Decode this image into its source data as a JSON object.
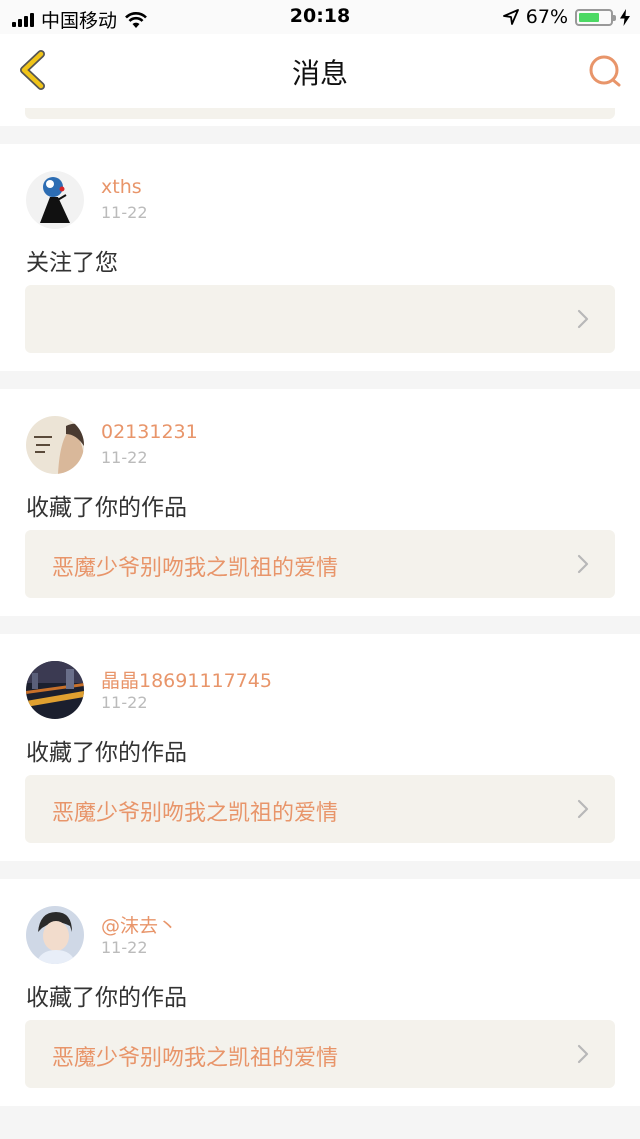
{
  "status_bar": {
    "carrier": "中国移动",
    "time": "20:18",
    "battery_percent": "67%",
    "battery_level": 0.67,
    "icons": [
      "signal-icon",
      "wifi-icon",
      "location-icon",
      "battery-icon",
      "charging-icon"
    ]
  },
  "nav": {
    "title": "消息",
    "back_icon": "chevron-left-icon",
    "search_icon": "search-icon"
  },
  "colors": {
    "accent": "#e8956a",
    "back_arrow": "#f0c419",
    "box_bg": "#f4f2ec",
    "page_bg": "#f5f5f5"
  },
  "messages": [
    {
      "username": "xths",
      "date": "11-22",
      "action": "关注了您",
      "work_title": ""
    },
    {
      "username": "02131231",
      "date": "11-22",
      "action": "收藏了你的作品",
      "work_title": "恶魔少爷别吻我之凯祖的爱情"
    },
    {
      "username": "晶晶18691117745",
      "date": "11-22",
      "action": "收藏了你的作品",
      "work_title": "恶魔少爷别吻我之凯祖的爱情"
    },
    {
      "username": "@沫去丶",
      "date": "11-22",
      "action": "收藏了你的作品",
      "work_title": "恶魔少爷别吻我之凯祖的爱情"
    }
  ]
}
